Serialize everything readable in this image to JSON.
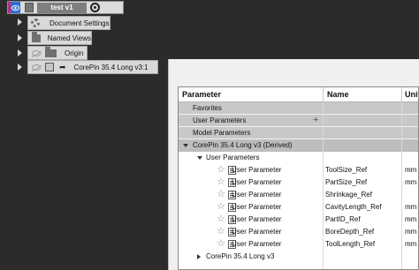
{
  "browser": {
    "root": {
      "title": "test v1"
    },
    "items": [
      {
        "label": "Document Settings",
        "icon": "gear-icon"
      },
      {
        "label": "Named Views",
        "icon": "folder-icon"
      },
      {
        "label": "Origin",
        "icon": "folder-icon"
      },
      {
        "label": "CorePin 35.4 Long v3:1",
        "icon": "component-icon"
      }
    ]
  },
  "parameters": {
    "columns": {
      "parameter": "Parameter",
      "name": "Name",
      "unit": "Unit"
    },
    "groups": {
      "favorites": "Favorites",
      "user": "User Parameters",
      "model": "Model Parameters",
      "derived": "CorePin 35.4 Long v3 (Derived)",
      "derived_user": "User Parameters",
      "collapsed": "CorePin 35.4 Long v3"
    },
    "rows": [
      {
        "type": "User Parameter",
        "name": "ToolSize_Ref",
        "unit": "mm"
      },
      {
        "type": "User Parameter",
        "name": "PartSize_Ref",
        "unit": "mm"
      },
      {
        "type": "User Parameter",
        "name": "Shrinkage_Ref",
        "unit": ""
      },
      {
        "type": "User Parameter",
        "name": "CavityLength_Ref",
        "unit": "mm"
      },
      {
        "type": "User Parameter",
        "name": "PartID_Ref",
        "unit": "mm"
      },
      {
        "type": "User Parameter",
        "name": "BoreDepth_Ref",
        "unit": "mm"
      },
      {
        "type": "User Parameter",
        "name": "ToolLength_Ref",
        "unit": "mm"
      }
    ]
  }
}
